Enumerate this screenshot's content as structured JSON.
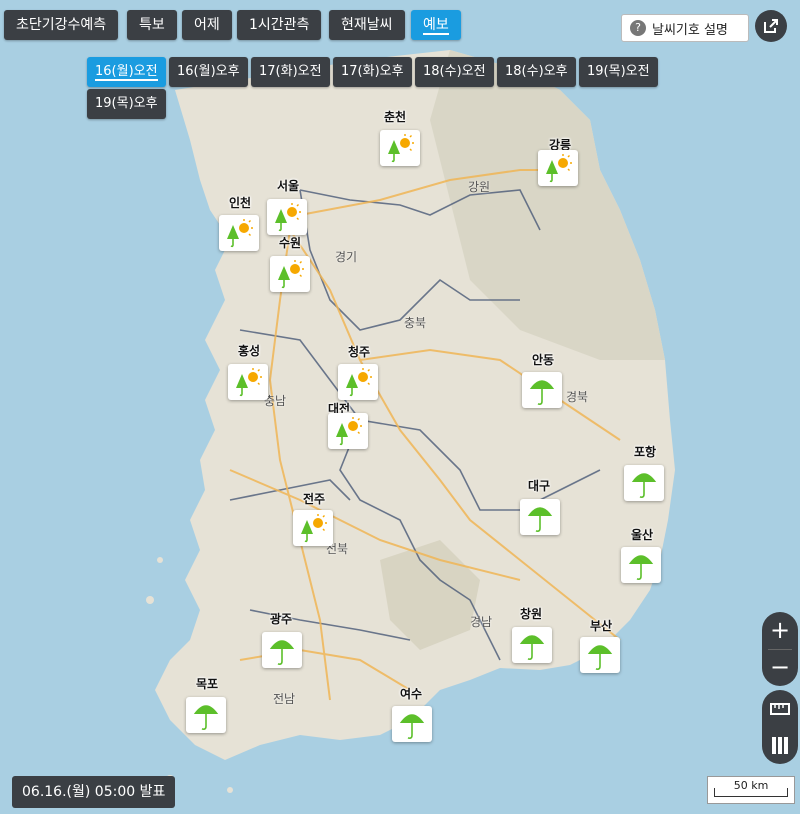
{
  "tabs": [
    {
      "label": "초단기강수예측",
      "active": false
    },
    {
      "label": "특보",
      "active": false
    },
    {
      "label": "어제",
      "active": false
    },
    {
      "label": "1시간관측",
      "active": false
    },
    {
      "label": "현재날씨",
      "active": false
    },
    {
      "label": "예보",
      "active": true
    }
  ],
  "legend_button": {
    "label": "날씨기호 설명",
    "icon": "question-icon"
  },
  "share_button": {
    "icon": "external-link-icon"
  },
  "days": [
    {
      "label": "16(월)오전",
      "active": true
    },
    {
      "label": "16(월)오후",
      "active": false
    },
    {
      "label": "17(화)오전",
      "active": false
    },
    {
      "label": "17(화)오후",
      "active": false
    },
    {
      "label": "18(수)오전",
      "active": false
    },
    {
      "label": "18(수)오후",
      "active": false
    },
    {
      "label": "19(목)오전",
      "active": false
    },
    {
      "label": "19(목)오후",
      "active": false
    }
  ],
  "cities": [
    {
      "name": "춘천",
      "weather": "rain-sun"
    },
    {
      "name": "강릉",
      "weather": "rain-sun"
    },
    {
      "name": "서울",
      "weather": "rain-sun"
    },
    {
      "name": "인천",
      "weather": "rain-sun"
    },
    {
      "name": "수원",
      "weather": "rain-sun"
    },
    {
      "name": "홍성",
      "weather": "rain-sun"
    },
    {
      "name": "청주",
      "weather": "rain-sun"
    },
    {
      "name": "대전",
      "weather": "rain-sun"
    },
    {
      "name": "안동",
      "weather": "rain"
    },
    {
      "name": "포항",
      "weather": "rain"
    },
    {
      "name": "대구",
      "weather": "rain"
    },
    {
      "name": "전주",
      "weather": "rain-sun"
    },
    {
      "name": "울산",
      "weather": "rain"
    },
    {
      "name": "광주",
      "weather": "rain"
    },
    {
      "name": "창원",
      "weather": "rain"
    },
    {
      "name": "부산",
      "weather": "rain"
    },
    {
      "name": "목포",
      "weather": "rain"
    },
    {
      "name": "여수",
      "weather": "rain"
    }
  ],
  "regions": [
    "강원",
    "경기",
    "충북",
    "충남",
    "경북",
    "전북",
    "경남",
    "전남"
  ],
  "issued": "06.16.(월) 05:00 발표",
  "zoom": {
    "in": "+",
    "out": "−"
  },
  "scale": "50 km",
  "colors": {
    "accent": "#1a9ce0",
    "umbrella": "#5cbf2a",
    "sun": "#f6a800",
    "button": "#3b3f44"
  }
}
